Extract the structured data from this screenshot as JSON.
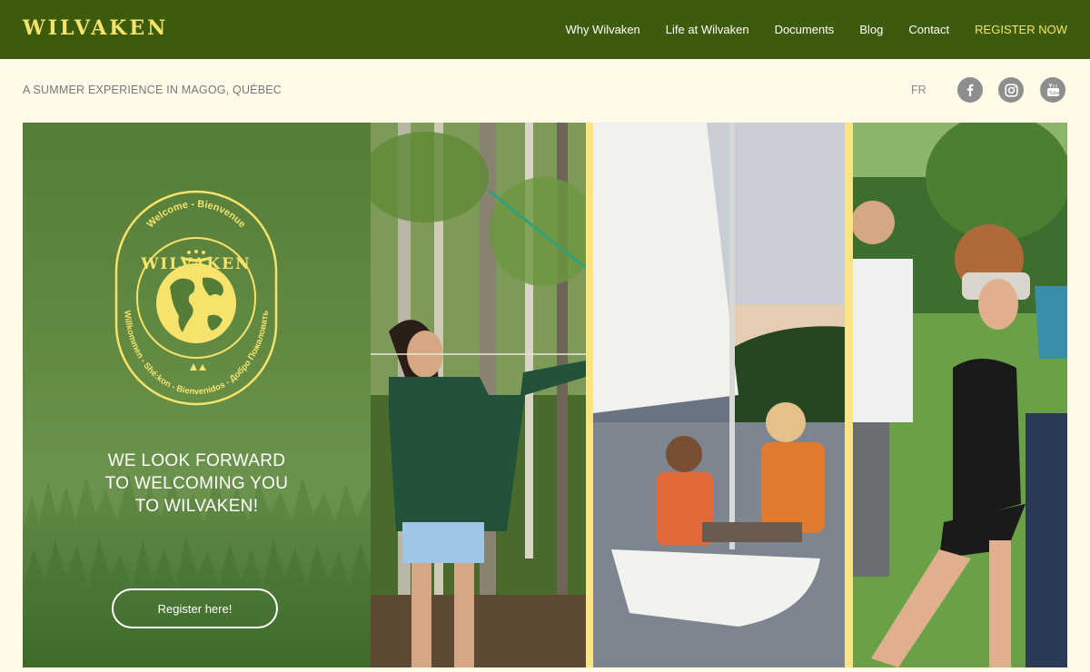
{
  "nav": {
    "brand": "WILVAKEN",
    "links": [
      {
        "label": "Why Wilvaken"
      },
      {
        "label": "Life at Wilvaken"
      },
      {
        "label": "Documents"
      },
      {
        "label": "Blog"
      },
      {
        "label": "Contact"
      },
      {
        "label": "REGISTER NOW"
      }
    ]
  },
  "subheader": {
    "tagline": "A SUMMER EXPERIENCE IN MAGOG, QUÉBEC",
    "lang": "FR",
    "social": [
      "facebook-icon",
      "instagram-icon",
      "youtube-icon"
    ]
  },
  "hero": {
    "emblem": {
      "top_arc": "Welcome - Bienvenue",
      "name": "WILVAKEN",
      "bottom_arc": "Willkommen - Shé:kon - Bienvenidos - Добро Пожаловать"
    },
    "welcome_lines": [
      "WE LOOK FORWARD",
      "TO WELCOMING YOU",
      "TO WILVAKEN!"
    ],
    "cta_label": "Register here!"
  },
  "colors": {
    "nav_bg": "#3c5b0c",
    "accent_yellow": "#f5e36b",
    "page_bg": "#fffbe8",
    "panel_green": "#648b44"
  }
}
